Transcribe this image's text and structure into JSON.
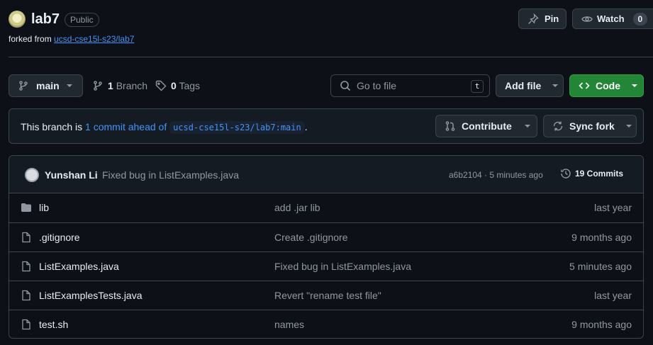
{
  "repo": {
    "name": "lab7",
    "visibility": "Public",
    "forked_prefix": "forked from",
    "forked_source": "ucsd-cse15l-s23/lab7"
  },
  "actions": {
    "pin_label": "Pin",
    "watch_label": "Watch",
    "watch_count": "0"
  },
  "toolbar": {
    "branch": "main",
    "branch_count": "1",
    "branch_label": "Branch",
    "tag_count": "0",
    "tag_label": "Tags",
    "search_placeholder": "Go to file",
    "search_shortcut": "t",
    "add_file_label": "Add file",
    "code_label": "Code",
    "code_color": "#238636"
  },
  "banner": {
    "prefix": "This branch is",
    "link": "1 commit ahead of",
    "ref": "ucsd-cse15l-s23/lab7:main",
    "suffix": ".",
    "contribute_label": "Contribute",
    "sync_label": "Sync fork"
  },
  "latest_commit": {
    "author": "Yunshan Li",
    "message": "Fixed bug in ListExamples.java",
    "meta": "a6b2104 · 5 minutes ago",
    "commits_count": "19 Commits"
  },
  "files": [
    {
      "icon": "folder-icon",
      "name": "lib",
      "message": "add .jar lib",
      "date": "last year"
    },
    {
      "icon": "file-icon",
      "name": ".gitignore",
      "message": "Create .gitignore",
      "date": "9 months ago"
    },
    {
      "icon": "file-icon",
      "name": "ListExamples.java",
      "message": "Fixed bug in ListExamples.java",
      "date": "5 minutes ago"
    },
    {
      "icon": "file-icon",
      "name": "ListExamplesTests.java",
      "message": "Revert \"rename test file\"",
      "date": "last year"
    },
    {
      "icon": "file-icon",
      "name": "test.sh",
      "message": "names",
      "date": "9 months ago"
    }
  ]
}
